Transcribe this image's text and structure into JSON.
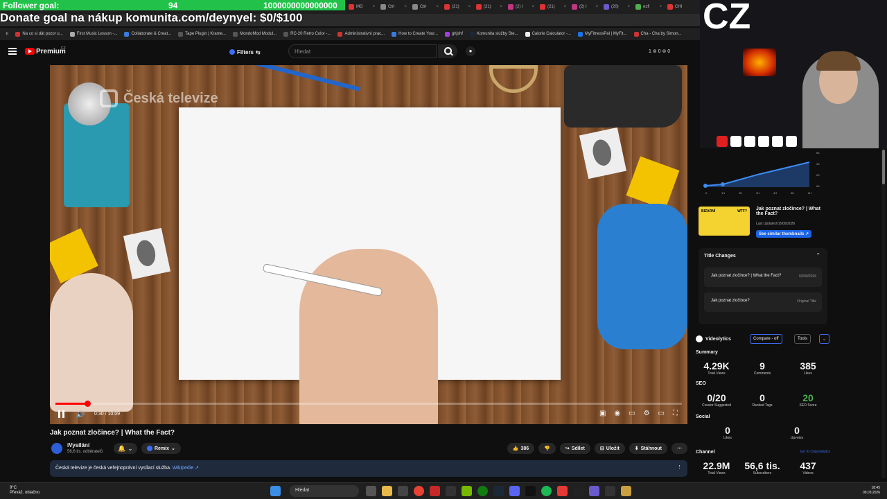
{
  "overlay": {
    "follower_label": "Follower goal:",
    "follower_count": "94",
    "follower_target": "1000000000000000",
    "donate_text": "Donate goal na nákup komunita.com/deynyel: $0/$100",
    "cam_text": "CZ"
  },
  "browser": {
    "tabs": [
      "MG",
      "Ctrl",
      "Ctrl",
      "(21)",
      "(21)",
      "(2) I",
      "(21)",
      "(2) I",
      "(20)",
      "ezfi",
      "CHI"
    ],
    "bookmarks": [
      "Na co si dát pozor u...",
      "First Music Lesson -...",
      "Collaborate & Creat...",
      "Tape Plugin | Krame...",
      "MondoMod Modul...",
      "RC-20 Retro Color -...",
      "Administrativní prac...",
      "How to Create Your...",
      "ghjshf",
      "Komunita služby Ste...",
      "Calorie Calculator -...",
      "MyFitnessPal | MyFit...",
      "Cha - Cha by Simon..."
    ]
  },
  "youtube": {
    "logo": "Premium",
    "country": "CZ",
    "filters": "Filters",
    "search_placeholder": "Hledat",
    "counters": "1 ⊚ 0 ⊚ 0"
  },
  "video": {
    "watermark": "Česká televize",
    "time": "0:30 / 10:09",
    "progress": 0.051,
    "title": "Jak poznat zločince? | What the Fact?"
  },
  "channel": {
    "name": "iVysílání",
    "subscribers": "56,6 tis. odběratelů",
    "remix": "Remix",
    "likes": "386",
    "share": "Sdílet",
    "save": "Uložit",
    "download": "Stáhnout",
    "info_text": "Česká televize je česká veřejnoprávní vysílací služba.",
    "info_link": "Wikipedie ↗"
  },
  "side": {
    "graph_labels": [
      "0",
      "1H",
      "2H",
      "3H",
      "4H",
      "5H",
      "6H"
    ],
    "graph_y": [
      "6K",
      "4K",
      "2K",
      "0K"
    ],
    "thumb_text": "BIZARNÍ",
    "thumb_tag": "WTF?",
    "thumb_title": "Jak poznat zločince? | What the Fact?",
    "thumb_updated": "Last Updated 03/09/2026",
    "similar_btn": "See similar thumbnails ↗",
    "title_changes": "Title Changes",
    "tc_rows": [
      {
        "title": "Jak poznat zločince? | What the Fact?",
        "tag": "03/09/2026"
      },
      {
        "title": "Jak poznat zločince?",
        "tag": "Original Title"
      }
    ]
  },
  "videolytics": {
    "name": "Videolytics",
    "compare": "Compare - off",
    "tools": "Tools",
    "summary": "Summary",
    "total_views": "4.29K",
    "total_views_l": "Total Views",
    "comments": "9",
    "comments_l": "Comments",
    "likes": "385",
    "likes_l": "Likes",
    "seo": "SEO",
    "creator": "0/20",
    "creator_l": "Creator Suggested",
    "ranked": "0",
    "ranked_l": "Ranked Tags",
    "score": "20",
    "score_l": "SEO Score",
    "social": "Social",
    "s_likes": "0",
    "s_likes_l": "Likes",
    "upvotes": "0",
    "upvotes_l": "Upvotes",
    "channel": "Channel",
    "go_to": "Go To Channelytics",
    "ch_views": "22.9M",
    "ch_views_l": "Total Views",
    "ch_subs": "56,6 tis.",
    "ch_subs_l": "Subscribers",
    "ch_videos": "437",
    "ch_videos_l": "Videos"
  },
  "taskbar": {
    "temp": "9°C",
    "weather": "Převáž. oblačno",
    "search": "Hledat",
    "time": "18:45",
    "date": "09.03.2026"
  },
  "colors": {
    "accent": "#3d6df2",
    "red": "#ff0000",
    "follower_bg": "#22c24a"
  }
}
